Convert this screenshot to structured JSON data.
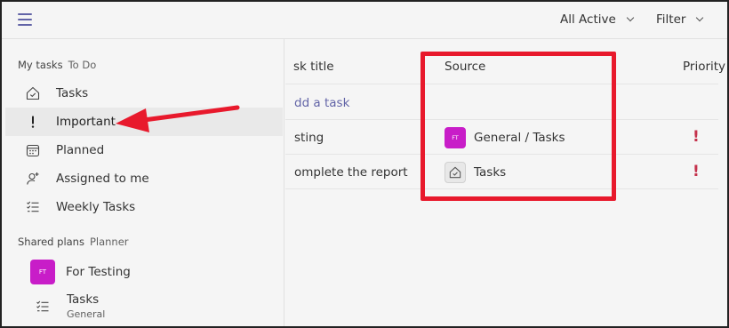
{
  "topbar": {
    "filter_active": "All Active",
    "filter": "Filter"
  },
  "sidebar": {
    "my_tasks": {
      "title": "My tasks",
      "subtitle": "To Do"
    },
    "items": [
      {
        "label": "Tasks",
        "icon": "house-check-icon"
      },
      {
        "label": "Important",
        "icon": "exclamation-icon"
      },
      {
        "label": "Planned",
        "icon": "calendar-icon"
      },
      {
        "label": "Assigned to me",
        "icon": "person-add-icon"
      },
      {
        "label": "Weekly Tasks",
        "icon": "checklist-icon"
      }
    ],
    "shared_plans": {
      "title": "Shared plans",
      "subtitle": "Planner"
    },
    "plans": [
      {
        "badge": "FT",
        "label": "For Testing"
      },
      {
        "label": "Tasks",
        "sublabel": "General",
        "icon": "checklist-icon"
      }
    ]
  },
  "main": {
    "columns": {
      "title": "sk title",
      "source": "Source",
      "priority": "Priority"
    },
    "add_task": "dd a task",
    "tasks": [
      {
        "title": "sting",
        "source": "General / Tasks",
        "source_badge": "FT",
        "priority": "!"
      },
      {
        "title": "omplete the report",
        "source": "Tasks",
        "source_icon": "house-check-icon",
        "priority": "!"
      }
    ]
  },
  "colors": {
    "accent": "#6264a7",
    "plan_badge": "#c81dc8",
    "priority": "#c4314b",
    "annotation": "#e8192c"
  }
}
